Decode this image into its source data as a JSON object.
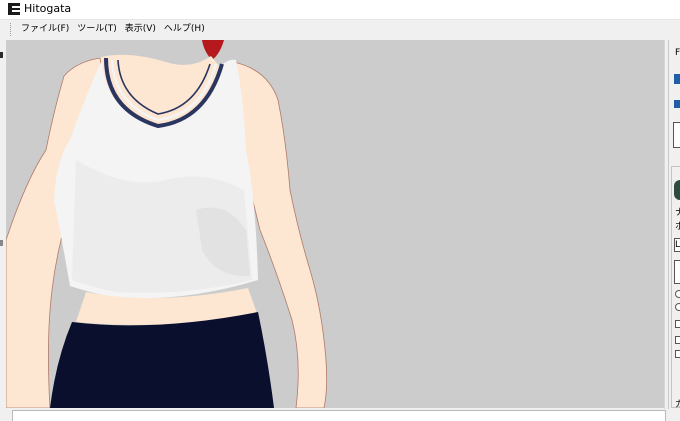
{
  "window": {
    "title": "Hitogata"
  },
  "menubar": {
    "items": [
      {
        "label": "ファイル(F)"
      },
      {
        "label": "ツール(T)"
      },
      {
        "label": "表示(V)"
      },
      {
        "label": "ヘルプ(H)"
      }
    ]
  },
  "side_panel": {
    "fragments": [
      "F",
      "ナ",
      "ホ",
      "L",
      "カ"
    ]
  },
  "colors": {
    "viewport_bg": "#cccccc",
    "skin": "#fde6d2",
    "top_shirt": "#f4f4f4",
    "neckline_trim": "#2a3560",
    "pants": "#0a0f2e",
    "hair": "#b5181d"
  }
}
